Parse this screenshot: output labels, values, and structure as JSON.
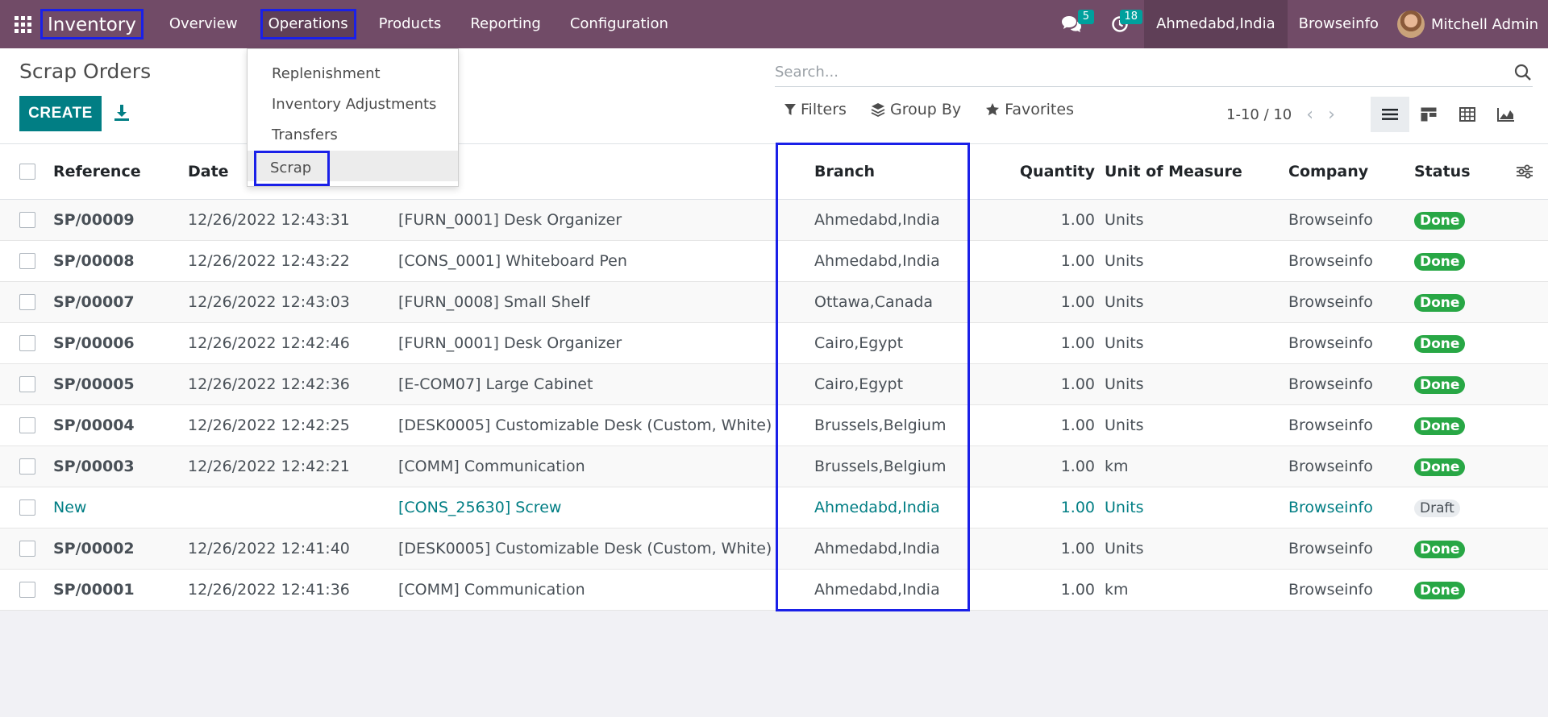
{
  "navbar": {
    "app_title": "Inventory",
    "menu": [
      "Overview",
      "Operations",
      "Products",
      "Reporting",
      "Configuration"
    ],
    "messages_count": "5",
    "activities_count": "18",
    "branch": "Ahmedabd,India",
    "company": "Browseinfo",
    "user": "Mitchell Admin"
  },
  "dropdown": {
    "items": [
      "Replenishment",
      "Inventory Adjustments",
      "Transfers",
      "Scrap"
    ]
  },
  "control": {
    "title": "Scrap Orders",
    "create_label": "CREATE",
    "search_placeholder": "Search...",
    "filters_label": "Filters",
    "groupby_label": "Group By",
    "favorites_label": "Favorites",
    "pager": "1-10 / 10"
  },
  "table": {
    "headers": {
      "reference": "Reference",
      "date": "Date",
      "branch": "Branch",
      "quantity": "Quantity",
      "uom": "Unit of Measure",
      "company": "Company",
      "status": "Status"
    },
    "rows": [
      {
        "ref": "SP/00009",
        "date": "12/26/2022 12:43:31",
        "product": "[FURN_0001] Desk Organizer",
        "branch": "Ahmedabd,India",
        "qty": "1.00",
        "uom": "Units",
        "company": "Browseinfo",
        "status": "Done"
      },
      {
        "ref": "SP/00008",
        "date": "12/26/2022 12:43:22",
        "product": "[CONS_0001] Whiteboard Pen",
        "branch": "Ahmedabd,India",
        "qty": "1.00",
        "uom": "Units",
        "company": "Browseinfo",
        "status": "Done"
      },
      {
        "ref": "SP/00007",
        "date": "12/26/2022 12:43:03",
        "product": "[FURN_0008] Small Shelf",
        "branch": "Ottawa,Canada",
        "qty": "1.00",
        "uom": "Units",
        "company": "Browseinfo",
        "status": "Done"
      },
      {
        "ref": "SP/00006",
        "date": "12/26/2022 12:42:46",
        "product": "[FURN_0001] Desk Organizer",
        "branch": "Cairo,Egypt",
        "qty": "1.00",
        "uom": "Units",
        "company": "Browseinfo",
        "status": "Done"
      },
      {
        "ref": "SP/00005",
        "date": "12/26/2022 12:42:36",
        "product": "[E-COM07] Large Cabinet",
        "branch": "Cairo,Egypt",
        "qty": "1.00",
        "uom": "Units",
        "company": "Browseinfo",
        "status": "Done"
      },
      {
        "ref": "SP/00004",
        "date": "12/26/2022 12:42:25",
        "product": "[DESK0005] Customizable Desk (Custom, White)",
        "branch": "Brussels,Belgium",
        "qty": "1.00",
        "uom": "Units",
        "company": "Browseinfo",
        "status": "Done"
      },
      {
        "ref": "SP/00003",
        "date": "12/26/2022 12:42:21",
        "product": "[COMM] Communication",
        "branch": "Brussels,Belgium",
        "qty": "1.00",
        "uom": "km",
        "company": "Browseinfo",
        "status": "Done"
      },
      {
        "ref": "New",
        "date": "",
        "product": "[CONS_25630] Screw",
        "branch": "Ahmedabd,India",
        "qty": "1.00",
        "uom": "Units",
        "company": "Browseinfo",
        "status": "Draft"
      },
      {
        "ref": "SP/00002",
        "date": "12/26/2022 12:41:40",
        "product": "[DESK0005] Customizable Desk (Custom, White)",
        "branch": "Ahmedabd,India",
        "qty": "1.00",
        "uom": "Units",
        "company": "Browseinfo",
        "status": "Done"
      },
      {
        "ref": "SP/00001",
        "date": "12/26/2022 12:41:36",
        "product": "[COMM] Communication",
        "branch": "Ahmedabd,India",
        "qty": "1.00",
        "uom": "km",
        "company": "Browseinfo",
        "status": "Done"
      }
    ]
  },
  "colors": {
    "navbar": "#714b67",
    "primary": "#017e84",
    "done": "#28a745",
    "highlight": "#1a20e8"
  }
}
